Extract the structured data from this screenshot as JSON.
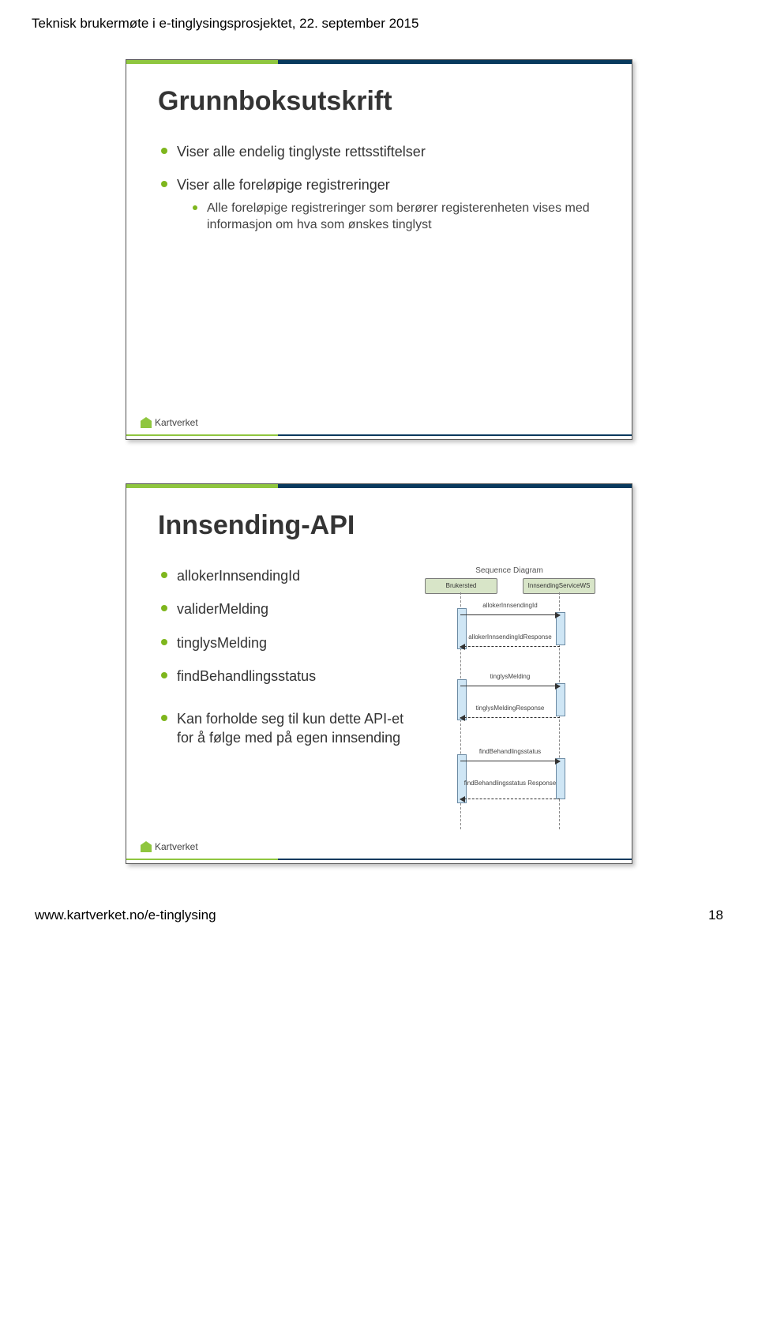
{
  "header": "Teknisk brukermøte i e-tinglysingsprosjektet, 22. september 2015",
  "slide1": {
    "title": "Grunnboksutskrift",
    "b1": "Viser alle endelig tinglyste rettsstiftelser",
    "b2": "Viser alle foreløpige registreringer",
    "b2_sub": "Alle foreløpige registreringer som berører registerenheten vises med informasjon om hva som ønskes tinglyst"
  },
  "slide2": {
    "title": "Innsending-API",
    "b1": "allokerInnsendingId",
    "b2": "validerMelding",
    "b3": "tinglysMelding",
    "b4": "findBehandlingsstatus",
    "b5": "Kan forholde seg til kun dette API-et for å følge med på egen innsending",
    "seq": {
      "title": "Sequence Diagram",
      "actor_left": "Brukersted",
      "actor_right": "InnsendingServiceWS",
      "m1": "allokerInnsendingId",
      "m2": "allokerInnsendingIdResponse",
      "m3": "tinglysMelding",
      "m4": "tinglysMeldingResponse",
      "m5": "findBehandlingsstatus",
      "m6": "findBehandlingsstatus Response"
    }
  },
  "logo_text": "Kartverket",
  "footer_left": "www.kartverket.no/e-tinglysing",
  "footer_right": "18"
}
